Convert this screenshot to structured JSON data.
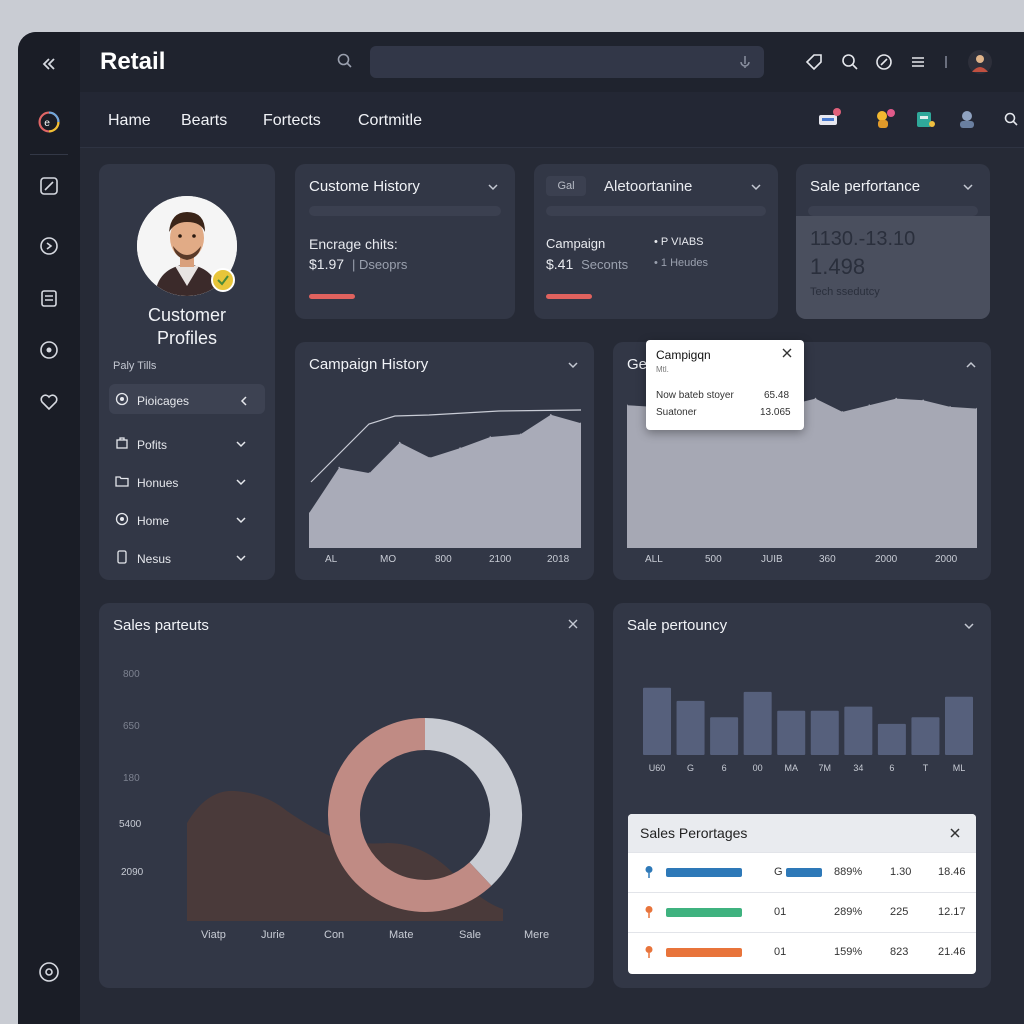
{
  "app": {
    "title": "Retail"
  },
  "nav": [
    "Hame",
    "Bearts",
    "Fortects",
    "Cortmitle"
  ],
  "profile": {
    "title_line1": "Customer",
    "title_line2": "Profiles",
    "section_label": "Paly Tills",
    "items": [
      {
        "label": "Pioicages",
        "icon": "circle-icon"
      },
      {
        "label": "Pofits",
        "icon": "bag-icon"
      },
      {
        "label": "Honues",
        "icon": "folder-icon"
      },
      {
        "label": "Home",
        "icon": "circle-icon"
      },
      {
        "label": "Nesus",
        "icon": "phone-icon"
      }
    ]
  },
  "customer_history": {
    "title": "Custome History",
    "label": "Encrage chits:",
    "value": "$1.97",
    "sub": "Dseoprs"
  },
  "mid_card": {
    "tag": "Gal",
    "title": "Aletoortanine",
    "label": "Campaign",
    "value": "$.41",
    "sub": "Seconts",
    "bullet1": "P VIABS",
    "bullet2": "1 Heudes"
  },
  "sale_perf_card": {
    "title": "Sale perfortance",
    "big1": "1130.-13.10",
    "big2": "1.498",
    "sub": "Tech ssedutcy"
  },
  "campaign_history": {
    "title": "Campaign History",
    "x_labels": [
      "AL",
      "MO",
      "800",
      "2100",
      "2018"
    ]
  },
  "area_card": {
    "title_partial": "Ge",
    "x_labels": [
      "ALL",
      "500",
      "JUIB",
      "360",
      "2000",
      "2000"
    ],
    "popup": {
      "title": "Campigqn",
      "sub": "Mtl.",
      "row1_label": "Now bateb stoyer",
      "row1_value": "65.48",
      "row2_label": "Suatoner",
      "row2_value": "13.065"
    }
  },
  "sales_parteuts": {
    "title": "Sales parteuts",
    "y_labels": [
      "800",
      "650",
      "180",
      "5400",
      "2090"
    ],
    "x_labels": [
      "Viatp",
      "Jurie",
      "Con",
      "Mate",
      "Sale",
      "Mere"
    ]
  },
  "sale_pertouncy": {
    "title": "Sale pertouncy",
    "x_labels": [
      "U60",
      "G",
      "6",
      "00",
      "MA",
      "7M",
      "34",
      "6",
      "T",
      "ML"
    ]
  },
  "sales_percentages": {
    "title": "Sales Perortages",
    "rows": [
      {
        "c1": "G",
        "c2": "889%",
        "c3": "1.30",
        "c4": "18.46"
      },
      {
        "c1": "01",
        "c2": "289%",
        "c3": "225",
        "c4": "12.17"
      },
      {
        "c1": "01",
        "c2": "159%",
        "c3": "823",
        "c4": "21.46"
      }
    ]
  },
  "chart_data": [
    {
      "type": "area",
      "title": "Campaign History",
      "categories": [
        "AL",
        "MO",
        "800",
        "2100",
        "2018"
      ],
      "series": [
        {
          "values": [
            0.25,
            0.58,
            0.54,
            0.76,
            0.65,
            0.72,
            0.8,
            0.82,
            0.96,
            0.9
          ]
        }
      ],
      "ylim": [
        0,
        1
      ]
    },
    {
      "type": "area",
      "categories": [
        "ALL",
        "500",
        "JUIB",
        "360",
        "2000",
        "2000"
      ],
      "series": [
        {
          "values": [
            0.86,
            0.85,
            0.8,
            0.84,
            0.88,
            0.87,
            0.86,
            0.9,
            0.82,
            0.86,
            0.9,
            0.89,
            0.85,
            0.84
          ]
        }
      ],
      "ylim": [
        0,
        1
      ]
    },
    {
      "type": "bar",
      "title": "Sale pertouncy",
      "categories": [
        "U60",
        "G",
        "6",
        "00",
        "MA",
        "7M",
        "34",
        "6",
        "T",
        "ML"
      ],
      "values": [
        82,
        66,
        46,
        77,
        54,
        54,
        59,
        38,
        46,
        71
      ],
      "ylim": [
        0,
        100
      ]
    },
    {
      "type": "pie",
      "title": "Sales parteuts",
      "values": [
        38,
        62
      ],
      "colors": [
        "#c9ccd3",
        "#c08b84"
      ]
    }
  ]
}
